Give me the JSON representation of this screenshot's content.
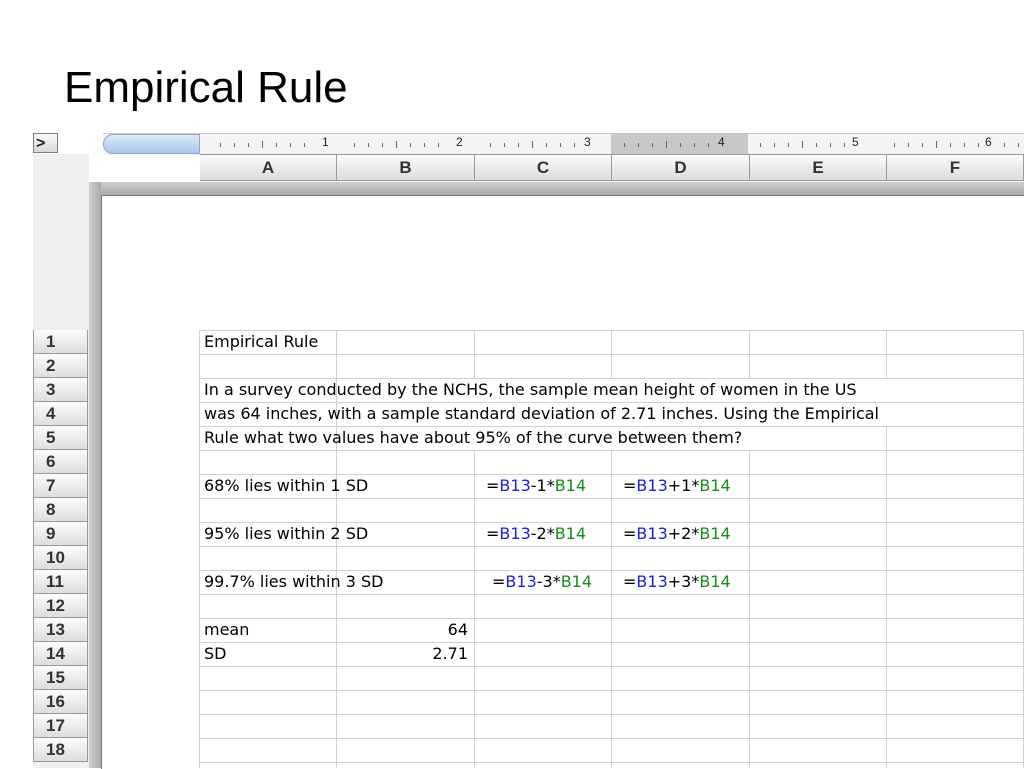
{
  "slide": {
    "title": "Empirical Rule"
  },
  "toolbar": {
    "expand_glyph": ">"
  },
  "ruler": {
    "numbers": [
      "1",
      "2",
      "3",
      "4",
      "5",
      "6"
    ]
  },
  "columns": [
    "A",
    "B",
    "C",
    "D",
    "E",
    "F"
  ],
  "rows": [
    "1",
    "2",
    "3",
    "4",
    "5",
    "6",
    "7",
    "8",
    "9",
    "10",
    "11",
    "12",
    "13",
    "14",
    "15",
    "16",
    "17",
    "18"
  ],
  "cells": {
    "a1": "Empirical Rule",
    "a3": "In a survey conducted by the NCHS, the sample mean height of women in the US",
    "a4": "was 64 inches, with a sample standard deviation of 2.71 inches.  Using the Empirical",
    "a5": "Rule what two values have about 95% of the curve between them?",
    "a7": "68% lies within 1 SD",
    "a9": "95% lies within 2 SD",
    "a11": "99.7% lies within 3 SD",
    "a13": "mean",
    "b13": "64",
    "a14": "SD",
    "b14": "2.71"
  },
  "formulas": {
    "c7": {
      "eq": "=",
      "ref1": "B13",
      "op": "-1*",
      "ref2": "B14"
    },
    "d7": {
      "eq": "=",
      "ref1": "B13",
      "op": "+1*",
      "ref2": "B14"
    },
    "c9": {
      "eq": "=",
      "ref1": "B13",
      "op": "-2*",
      "ref2": "B14"
    },
    "d9": {
      "eq": "=",
      "ref1": "B13",
      "op": "+2*",
      "ref2": "B14"
    },
    "c11": {
      "eq": "=",
      "ref1": "B13",
      "op": "-3*",
      "ref2": "B14"
    },
    "d11": {
      "eq": "=",
      "ref1": "B13",
      "op": "+3*",
      "ref2": "B14"
    }
  },
  "colors": {
    "ref1": "#1a22e0",
    "ref2": "#1a8a1a",
    "selected_ruler": "#c8c8c8"
  }
}
